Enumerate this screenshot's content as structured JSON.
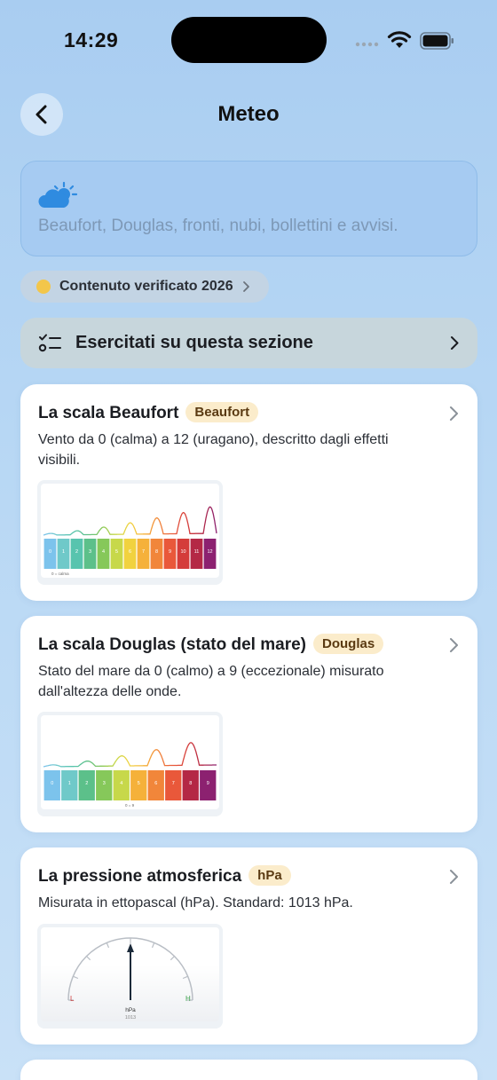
{
  "status": {
    "time": "14:29"
  },
  "nav": {
    "title": "Meteo"
  },
  "hero": {
    "icon": "partly-cloudy-icon",
    "description": "Beaufort, Douglas, fronti, nubi, bollettini e avvisi."
  },
  "verified": {
    "label": "Contenuto verificato 2026"
  },
  "practice": {
    "label": "Esercitati su questa sezione"
  },
  "cards": [
    {
      "title": "La scala Beaufort",
      "badge": "Beaufort",
      "description": "Vento da 0 (calma) a 12 (uragano), descritto dagli effetti visibili.",
      "scale_labels": [
        "0",
        "1",
        "2",
        "3",
        "4",
        "5",
        "6",
        "7",
        "8",
        "9",
        "10",
        "11",
        "12"
      ],
      "scale_caption": "0 = calma"
    },
    {
      "title": "La scala Douglas (stato del mare)",
      "badge": "Douglas",
      "description": "Stato del mare da 0 (calmo) a 9 (eccezionale) misurato dall'altezza delle onde.",
      "scale_labels": [
        "0",
        "1",
        "2",
        "3",
        "4",
        "5",
        "6",
        "7",
        "8",
        "9"
      ],
      "scale_caption": "0 = 9"
    },
    {
      "title": "La pressione atmosferica",
      "badge": "hPa",
      "description": "Misurata in ettopascal (hPa). Standard: 1013 hPa.",
      "gauge": {
        "low": "L",
        "high": "H",
        "unit": "hPa",
        "value": "1013"
      }
    }
  ],
  "colors": {
    "accent": "#3a8fe0",
    "badge_bg": "#fbeccb",
    "scale": [
      "#7cc3ec",
      "#6fc9c9",
      "#58c4ae",
      "#5cc08a",
      "#86c85a",
      "#c7d84a",
      "#f1d23f",
      "#f5b13a",
      "#f1863a",
      "#e9583a",
      "#d43c3a",
      "#b42845",
      "#8c2170"
    ]
  }
}
